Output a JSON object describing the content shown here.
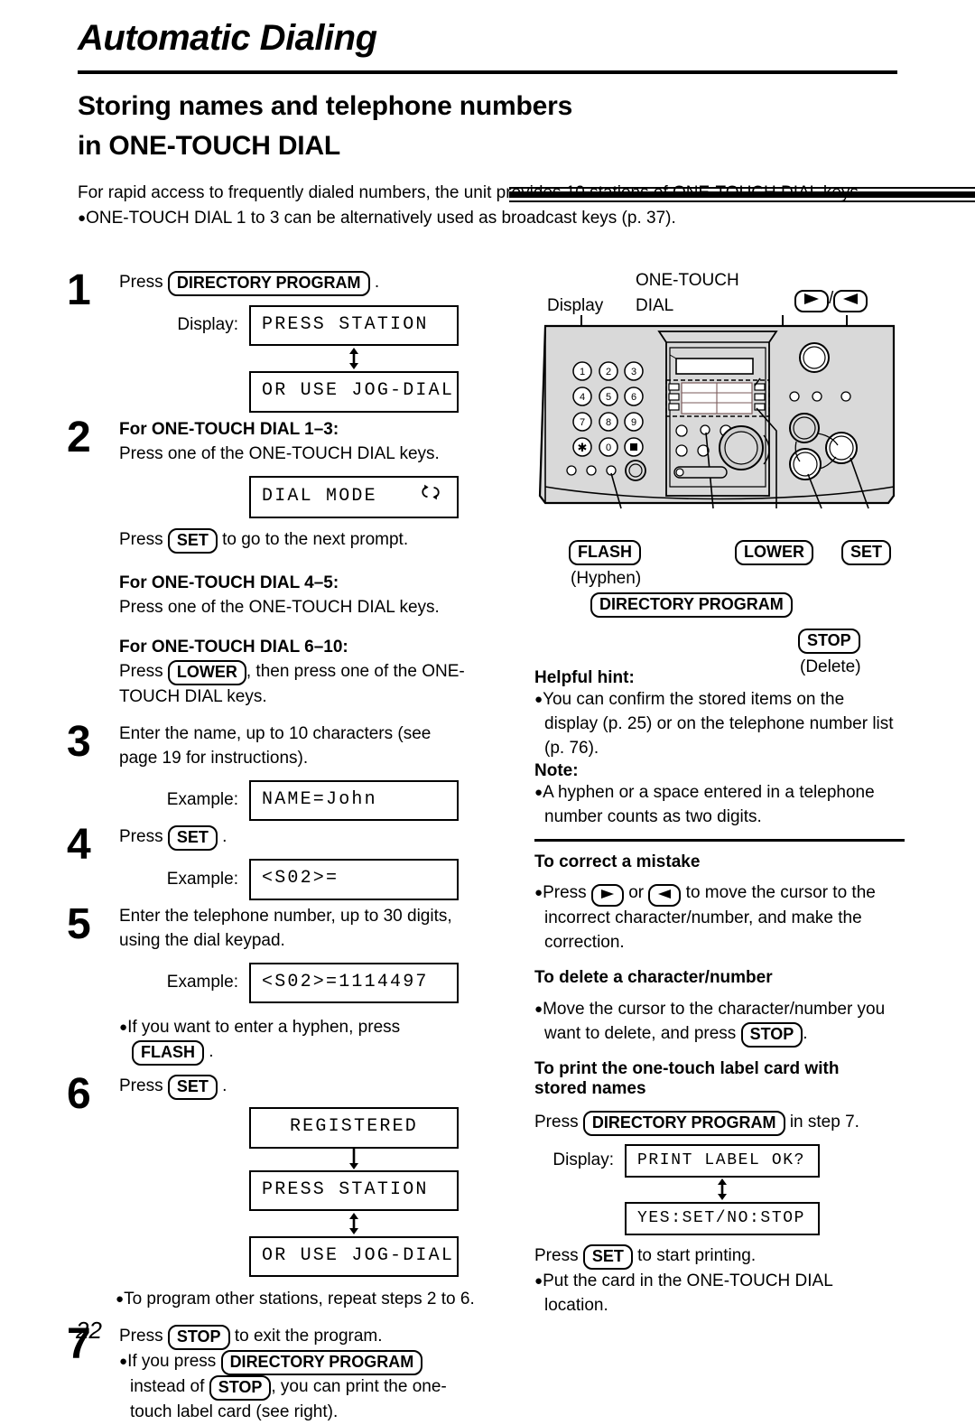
{
  "header": {
    "chapter_title": "Automatic Dialing",
    "section_title_line1": "Storing names and telephone numbers",
    "section_title_line2": "in ONE-TOUCH DIAL"
  },
  "intro": {
    "paragraph": "For rapid access to frequently dialed numbers, the unit provides 10 stations of ONE-TOUCH DIAL keys.",
    "bullet": "ONE-TOUCH DIAL 1 to 3 can be alternatively used as broadcast keys (p. 37)."
  },
  "steps": {
    "s1": {
      "num": "1",
      "press_label": "Press",
      "key": "DIRECTORY PROGRAM",
      "period": ".",
      "display_label": "Display:",
      "lcd1": "PRESS STATION",
      "lcd2": "OR USE JOG-DIAL"
    },
    "s2": {
      "num": "2",
      "head_1_3": "For ONE-TOUCH DIAL 1–3:",
      "text_1_3": "Press one of the ONE-TOUCH DIAL keys.",
      "lcd_dial_mode": "DIAL MODE",
      "press_label": "Press",
      "key_set": "SET",
      "tail": "to go to the next prompt.",
      "head_4_5": "For ONE-TOUCH DIAL 4–5:",
      "text_4_5": "Press one of the ONE-TOUCH DIAL keys.",
      "head_6_10": "For ONE-TOUCH DIAL 6–10:",
      "text_6_10_a": "Press",
      "key_lower": "LOWER",
      "text_6_10_b": ", then press one of the ONE-",
      "text_6_10_c": "TOUCH DIAL keys."
    },
    "s3": {
      "num": "3",
      "text_a": "Enter the name, up to 10 characters (see",
      "text_b": "page 19 for instructions).",
      "example_label": "Example:",
      "lcd": "NAME=John"
    },
    "s4": {
      "num": "4",
      "press_label": "Press",
      "key_set": "SET",
      "period": ".",
      "example_label": "Example:",
      "lcd": "<S02>="
    },
    "s5": {
      "num": "5",
      "text_a": "Enter the telephone number, up to 30 digits,",
      "text_b": "using the dial keypad.",
      "example_label": "Example:",
      "lcd": "<S02>=1114497",
      "bullet_a": "If you want to enter a hyphen, press",
      "key_flash": "FLASH",
      "bullet_b": "."
    },
    "s6": {
      "num": "6",
      "press_label": "Press",
      "key_set": "SET",
      "period": ".",
      "lcd1": "REGISTERED",
      "lcd2": "PRESS STATION",
      "lcd3": "OR USE JOG-DIAL",
      "bullet": "To program other stations, repeat steps 2 to 6."
    },
    "s7": {
      "num": "7",
      "press_label": "Press",
      "key_stop": "STOP",
      "tail": "to exit the program.",
      "bullet_a": "If you press",
      "key_dir": "DIRECTORY PROGRAM",
      "bullet_b": "instead of",
      "key_stop2": "STOP",
      "bullet_c": ", you can print the one-",
      "bullet_d": "touch label card (see right)."
    }
  },
  "device": {
    "label_display": "Display",
    "label_one_touch_line1": "ONE-TOUCH",
    "label_one_touch_line2": "DIAL",
    "keypad": [
      "1",
      "2",
      "3",
      "4",
      "5",
      "6",
      "7",
      "8",
      "9",
      "∗",
      "0",
      "■"
    ],
    "key_flash": "FLASH",
    "key_flash_sub": "(Hyphen)",
    "key_lower": "LOWER",
    "key_set": "SET",
    "key_directory": "DIRECTORY PROGRAM",
    "key_stop": "STOP",
    "key_stop_sub": "(Delete)"
  },
  "right": {
    "helpful_hint_head": "Helpful hint:",
    "helpful_hint_a": "You can confirm the stored items on the",
    "helpful_hint_b": "display (p. 25) or on the telephone number list",
    "helpful_hint_c": "(p. 76).",
    "note_head": "Note:",
    "note_a": "A hyphen or a space entered in a telephone",
    "note_b": "number counts as two digits.",
    "correct_head": "To correct a mistake",
    "correct_a": "Press",
    "correct_or": "or",
    "correct_b": "to move the cursor to the",
    "correct_c": "incorrect character/number, and make the",
    "correct_d": "correction.",
    "delete_head": "To delete a character/number",
    "delete_a": "Move the cursor to the character/number you",
    "delete_b": "want to delete, and press",
    "delete_key": "STOP",
    "delete_c": ".",
    "print_head_line1": "To print the one-touch label card with",
    "print_head_line2": "stored names",
    "print_press": "Press",
    "print_key": "DIRECTORY PROGRAM",
    "print_tail": "in step 7.",
    "display_label": "Display:",
    "lcd1": "PRINT LABEL OK?",
    "lcd2": "YES:SET/NO:STOP",
    "print_press2": "Press",
    "print_key2": "SET",
    "print_tail2": "to start printing.",
    "print_bullet_a": "Put the card in the ONE-TOUCH DIAL",
    "print_bullet_b": "location."
  },
  "page_number": "22"
}
